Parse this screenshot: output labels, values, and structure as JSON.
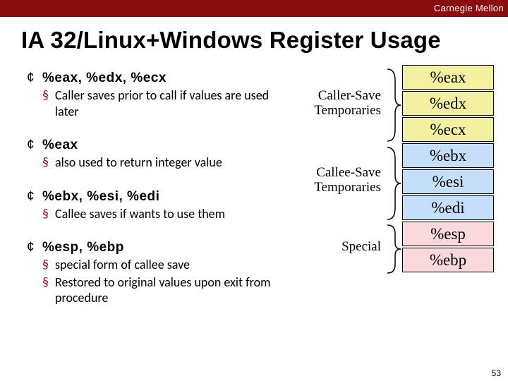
{
  "header": {
    "org": "Carnegie Mellon"
  },
  "title": "IA 32/Linux+Windows Register Usage",
  "bullets": [
    {
      "head": "%eax, %edx, %ecx",
      "subs": [
        "Caller saves prior to call if values are used later"
      ]
    },
    {
      "head": "%eax",
      "subs": [
        "also used to return integer value"
      ]
    },
    {
      "head": "%ebx, %esi, %edi",
      "subs": [
        "Callee saves if wants to use them"
      ]
    },
    {
      "head": "%esp, %ebp",
      "subs": [
        "special form of callee save",
        "Restored to original values upon exit from procedure"
      ]
    }
  ],
  "diagram": {
    "labels": {
      "callerSave": "Caller-Save Temporaries",
      "calleeSave": "Callee-Save Temporaries",
      "special": "Special"
    },
    "registers": [
      {
        "name": "%eax",
        "class": "yel"
      },
      {
        "name": "%edx",
        "class": "yel"
      },
      {
        "name": "%ecx",
        "class": "yel"
      },
      {
        "name": "%ebx",
        "class": "blu"
      },
      {
        "name": "%esi",
        "class": "blu"
      },
      {
        "name": "%edi",
        "class": "blu"
      },
      {
        "name": "%esp",
        "class": "pnk"
      },
      {
        "name": "%ebp",
        "class": "pnk"
      }
    ]
  },
  "pagenum": "53"
}
